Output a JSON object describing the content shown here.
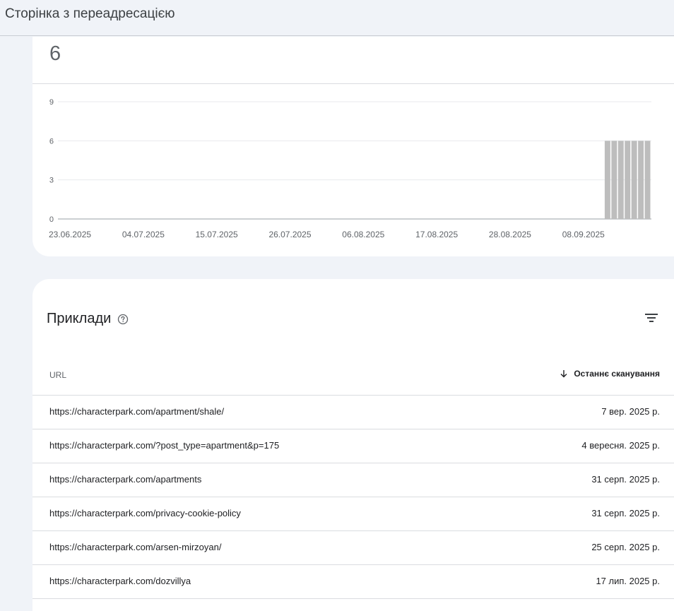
{
  "header": {
    "title": "Сторінка з переадресацією"
  },
  "summary": {
    "count": "6"
  },
  "chart_data": {
    "type": "bar",
    "x_tick_labels": [
      "23.06.2025",
      "04.07.2025",
      "15.07.2025",
      "26.07.2025",
      "06.08.2025",
      "17.08.2025",
      "28.08.2025",
      "08.09.2025"
    ],
    "y_ticks": [
      "9",
      "6",
      "3",
      "0"
    ],
    "ylim": [
      0,
      9
    ],
    "date_range": [
      "23.06.2025",
      "20.09.2025"
    ],
    "dates": [
      "13.09.2025",
      "14.09.2025",
      "15.09.2025",
      "16.09.2025",
      "17.09.2025",
      "18.09.2025",
      "19.09.2025"
    ],
    "values": [
      6,
      6,
      6,
      6,
      6,
      6,
      6
    ],
    "bar_color": "#bdbdbd",
    "grid": true
  },
  "examples": {
    "title": "Приклади",
    "help_icon": "help-circle-icon",
    "filter_icon": "filter-list-icon",
    "columns": {
      "url": "URL",
      "last_crawl": "Останнє сканування"
    },
    "rows": [
      {
        "url": "https://characterpark.com/apartment/shale/",
        "date": "7 вер. 2025 р."
      },
      {
        "url": "https://characterpark.com/?post_type=apartment&p=175",
        "date": "4 вересня. 2025 р."
      },
      {
        "url": "https://characterpark.com/apartments",
        "date": "31 серп. 2025 р."
      },
      {
        "url": "https://characterpark.com/privacy-cookie-policy",
        "date": "31 серп. 2025 р."
      },
      {
        "url": "https://characterpark.com/arsen-mirzoyan/",
        "date": "25 серп. 2025 р."
      },
      {
        "url": "https://characterpark.com/dozvillya",
        "date": "17 лип. 2025 р."
      }
    ]
  }
}
